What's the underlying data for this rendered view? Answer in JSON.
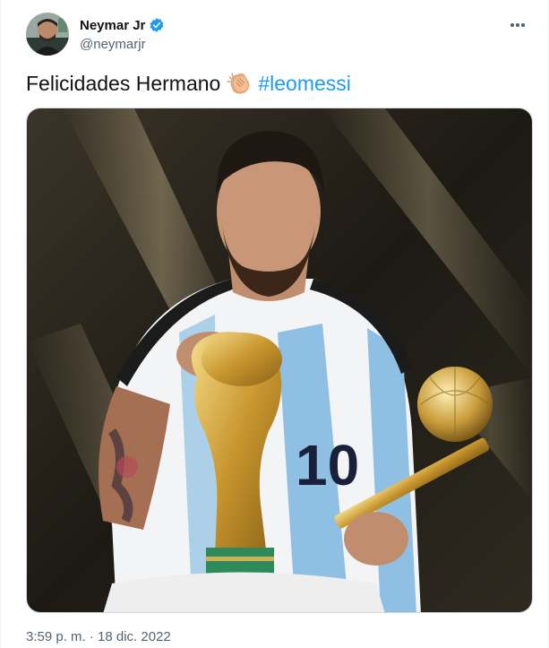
{
  "tweet": {
    "author": {
      "display_name": "Neymar Jr",
      "handle": "@neymarjr",
      "verified": true
    },
    "text": "Felicidades Hermano",
    "emoji": "clapping-hands",
    "hashtag": "#leomessi",
    "timestamp": "3:59 p. m. · 18 dic. 2022"
  },
  "icons": {
    "verified": "verified-badge-icon",
    "more": "more-options-icon"
  },
  "colors": {
    "accent": "#1d9bf0",
    "text": "#0f1419",
    "secondary": "#536471"
  }
}
